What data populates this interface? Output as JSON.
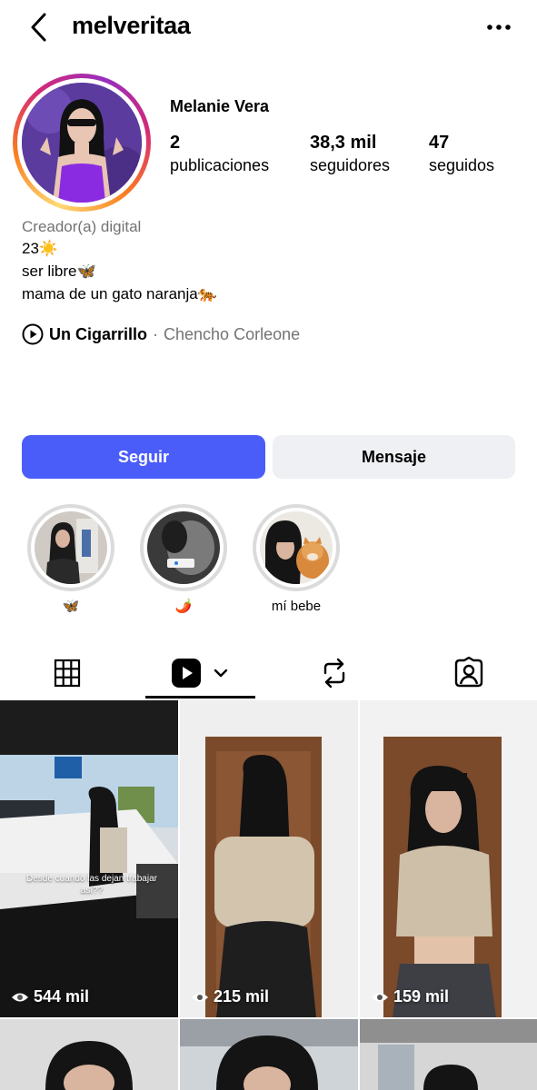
{
  "header": {
    "username": "melveritaa"
  },
  "profile": {
    "full_name": "Melanie Vera",
    "stats": [
      {
        "value": "2",
        "label": "publicaciones"
      },
      {
        "value": "38,3 mil",
        "label": "seguidores"
      },
      {
        "value": "47",
        "label": "seguidos"
      }
    ],
    "category": "Creador(a) digital",
    "bio": [
      "23☀️",
      "ser libre🦋",
      "mama de un gato naranja🐅"
    ],
    "music": {
      "song": "Un Cigarrillo",
      "separator": "·",
      "artist": "Chencho Corleone"
    }
  },
  "actions": {
    "follow_label": "Seguir",
    "message_label": "Mensaje"
  },
  "highlights": [
    {
      "label": "🦋"
    },
    {
      "label": "🌶️"
    },
    {
      "label": "mí bebe"
    }
  ],
  "tabs": [
    {
      "icon": "grid-icon"
    },
    {
      "icon": "reels-icon",
      "active": true
    },
    {
      "icon": "reposts-icon"
    },
    {
      "icon": "tagged-icon"
    }
  ],
  "posts": [
    {
      "views": "544 mil",
      "caption": "Desde cuando las dejan trabajar así??"
    },
    {
      "views": "215 mil"
    },
    {
      "views": "159 mil"
    }
  ],
  "colors": {
    "follow_button": "#4a5df9",
    "message_button": "#eff0f3",
    "secondary_text": "#737373"
  }
}
